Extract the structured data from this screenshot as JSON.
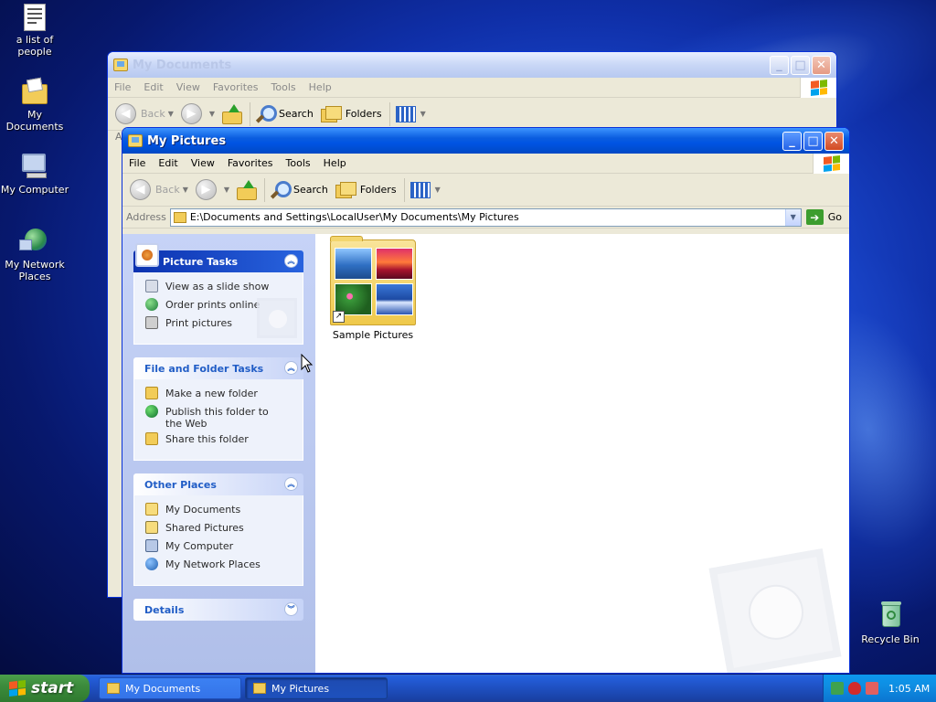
{
  "desktop": {
    "icons": [
      {
        "label": "a list of people",
        "icon": "text-document-icon"
      },
      {
        "label": "My Documents",
        "icon": "my-documents-icon"
      },
      {
        "label": "My Computer",
        "icon": "my-computer-icon"
      },
      {
        "label": "My Network Places",
        "icon": "network-places-icon"
      },
      {
        "label": "Recycle Bin",
        "icon": "recycle-bin-icon"
      }
    ]
  },
  "back_window": {
    "title": "My Documents",
    "menu": [
      "File",
      "Edit",
      "View",
      "Favorites",
      "Tools",
      "Help"
    ],
    "toolbar": {
      "back": "Back",
      "search": "Search",
      "folders": "Folders"
    },
    "address_fragment": "A"
  },
  "front_window": {
    "title": "My Pictures",
    "menu": [
      "File",
      "Edit",
      "View",
      "Favorites",
      "Tools",
      "Help"
    ],
    "toolbar": {
      "back": "Back",
      "search": "Search",
      "folders": "Folders"
    },
    "address": {
      "label": "Address",
      "value": "E:\\Documents and Settings\\LocalUser\\My Documents\\My Pictures",
      "go": "Go"
    },
    "task_panes": {
      "picture_tasks": {
        "title": "Picture Tasks",
        "items": [
          "View as a slide show",
          "Order prints online",
          "Print pictures"
        ]
      },
      "file_folder_tasks": {
        "title": "File and Folder Tasks",
        "items": [
          "Make a new folder",
          "Publish this folder to the Web",
          "Share this folder"
        ]
      },
      "other_places": {
        "title": "Other Places",
        "items": [
          "My Documents",
          "Shared Pictures",
          "My Computer",
          "My Network Places"
        ]
      },
      "details": {
        "title": "Details"
      }
    },
    "items": [
      {
        "label": "Sample Pictures",
        "shortcut": "↗"
      }
    ]
  },
  "taskbar": {
    "start": "start",
    "tasks": [
      "My Documents",
      "My Pictures"
    ],
    "active_task": "My Pictures",
    "clock": "1:05 AM"
  },
  "colors": {
    "titlebar_active": "#0054e3",
    "taskbar": "#245edb",
    "start_button": "#3c8b3c",
    "tray": "#0f8ee3"
  }
}
